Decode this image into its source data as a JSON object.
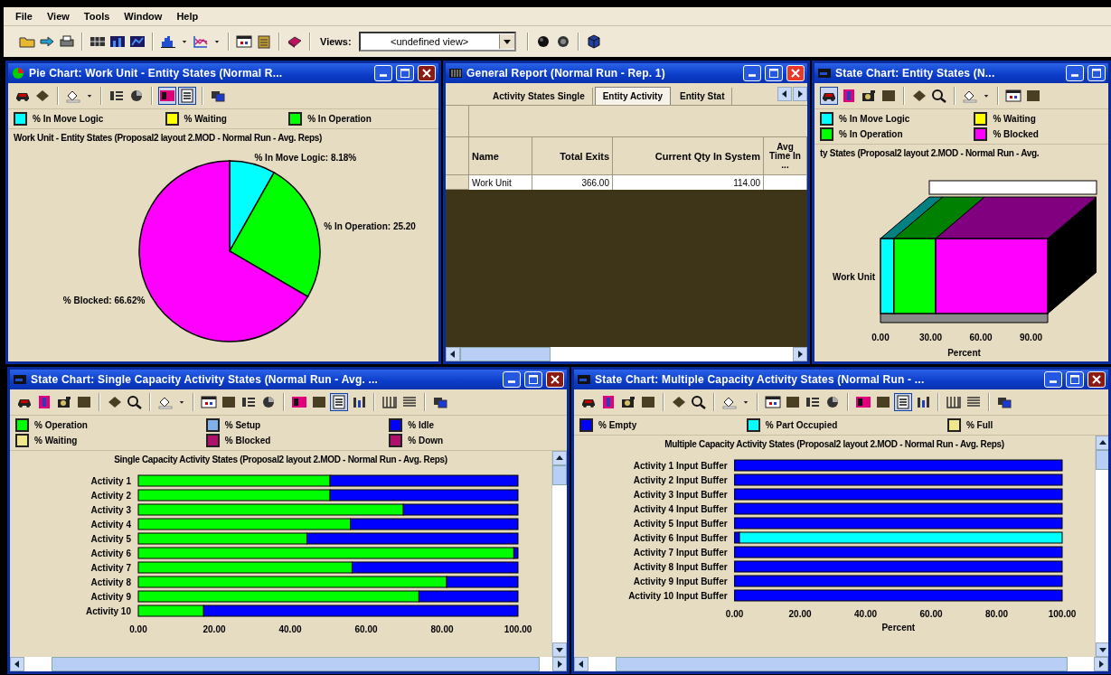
{
  "menu": [
    "File",
    "View",
    "Tools",
    "Window",
    "Help"
  ],
  "toolbar": {
    "left": [
      {
        "kind": "folder"
      },
      {
        "kind": "link"
      },
      {
        "kind": "printer"
      },
      {
        "kind": "sep"
      },
      {
        "kind": "table"
      },
      {
        "kind": "barchart"
      },
      {
        "kind": "barchart2"
      },
      {
        "kind": "sep"
      },
      {
        "kind": "histogram"
      },
      {
        "kind": "caret"
      },
      {
        "kind": "linechart"
      },
      {
        "kind": "caret"
      },
      {
        "kind": "sep"
      },
      {
        "kind": "window"
      },
      {
        "kind": "doc"
      },
      {
        "kind": "sep"
      },
      {
        "kind": "book"
      },
      {
        "kind": "sep"
      }
    ],
    "views_label": "Views:",
    "views_value": "<undefined view>",
    "right": [
      {
        "kind": "sep"
      },
      {
        "kind": "ball"
      },
      {
        "kind": "ball2"
      },
      {
        "kind": "sep"
      },
      {
        "kind": "cube"
      }
    ]
  },
  "windows": [
    {
      "kind": "pie",
      "title": "Pie Chart: Work Unit - Entity States (Normal R...",
      "active": false,
      "buttons": [
        {
          "kind": "minimize"
        },
        {
          "kind": "maximize"
        },
        {
          "kind": "close"
        }
      ],
      "toolbar": [
        {
          "kind": "car",
          "pressed": false
        },
        {
          "kind": "diamond",
          "pressed": false
        },
        {
          "kind": "sep"
        },
        {
          "kind": "paint",
          "pressed": false
        },
        {
          "kind": "caret",
          "pressed": false
        },
        {
          "kind": "sep"
        },
        {
          "kind": "labels",
          "pressed": false
        },
        {
          "kind": "pie",
          "pressed": false
        },
        {
          "kind": "sep"
        },
        {
          "kind": "legend",
          "pressed": true
        },
        {
          "kind": "text",
          "pressed": true
        },
        {
          "kind": "sep"
        },
        {
          "kind": "copy",
          "pressed": false
        }
      ],
      "legend": [
        {
          "label": "% In Move Logic",
          "color": "#00ffff"
        },
        {
          "label": "% Waiting",
          "color": "#ffff00"
        },
        {
          "label": "% In Operation",
          "color": "#00ff00"
        }
      ],
      "chart_data": {
        "type": "pie",
        "title": "Work Unit - Entity States (Proposal2 layout 2.MOD - Normal Run - Avg. Reps)",
        "categories": [
          "% In Move Logic",
          "% In Operation",
          "% Blocked"
        ],
        "values": [
          8.18,
          25.2,
          66.62
        ],
        "colors": [
          "#00ffff",
          "#00ff00",
          "#ff00ff"
        ],
        "value_labels": [
          "8.18%",
          "25.20",
          "66.62%"
        ]
      }
    },
    {
      "kind": "report",
      "title": "General Report (Normal Run - Rep. 1)",
      "active": true,
      "buttons": [
        {
          "kind": "minimize"
        },
        {
          "kind": "maximize"
        },
        {
          "kind": "close"
        }
      ],
      "tabs": [
        {
          "label": "Activity States Single",
          "selected": false
        },
        {
          "label": "Entity Activity",
          "selected": true
        },
        {
          "label": "Entity Stat",
          "selected": false
        }
      ],
      "table": {
        "columns": [
          "Name",
          "Total Exits",
          "Current Qty In System",
          "Avg Time In ..."
        ],
        "rows": [
          [
            "Work Unit",
            "366.00",
            "114.00"
          ]
        ]
      }
    },
    {
      "kind": "state3d",
      "title": "State Chart: Entity States (N...",
      "buttons": [
        {
          "kind": "minimize"
        },
        {
          "kind": "maximize"
        }
      ],
      "toolbar": [
        {
          "kind": "car",
          "pressed": true
        },
        {
          "kind": "info",
          "pressed": false
        },
        {
          "kind": "camera",
          "pressed": false
        },
        {
          "kind": "square",
          "pressed": false
        },
        {
          "kind": "sep"
        },
        {
          "kind": "diamond",
          "pressed": false
        },
        {
          "kind": "search",
          "pressed": false
        },
        {
          "kind": "sep"
        },
        {
          "kind": "paint",
          "pressed": false
        },
        {
          "kind": "caret",
          "pressed": false
        },
        {
          "kind": "sep"
        },
        {
          "kind": "window",
          "pressed": false
        },
        {
          "kind": "square",
          "pressed": false
        }
      ],
      "chart_data": {
        "type": "bar",
        "orientation": "horizontal",
        "stacked": true,
        "title": "ty States (Proposal2 layout 2.MOD - Normal Run - Avg.",
        "categories": [
          "Work Unit"
        ],
        "series": [
          {
            "name": "% In Move Logic",
            "color": "#00ffff",
            "values": [
              8
            ]
          },
          {
            "name": "% In Operation",
            "color": "#00ff00",
            "values": [
              25
            ]
          },
          {
            "name": "% Waiting",
            "color": "#ffff00",
            "values": [
              0
            ]
          },
          {
            "name": "% Blocked",
            "color": "#ff00ff",
            "values": [
              67
            ]
          }
        ],
        "xlabel": "Percent",
        "xlim": [
          0,
          100
        ],
        "xticks": [
          {
            "value": 0,
            "label": "0.00"
          },
          {
            "value": 30,
            "label": "30.00"
          },
          {
            "value": 60,
            "label": "60.00"
          },
          {
            "value": 90,
            "label": "90.00"
          }
        ]
      }
    },
    {
      "kind": "hbar",
      "title": "State Chart: Single Capacity Activity States (Normal Run - Avg. ...",
      "active": false,
      "buttons": [
        {
          "kind": "minimize"
        },
        {
          "kind": "maximize"
        },
        {
          "kind": "close"
        }
      ],
      "toolbar": [
        {
          "kind": "car",
          "pressed": false
        },
        {
          "kind": "info",
          "pressed": false
        },
        {
          "kind": "camera",
          "pressed": false
        },
        {
          "kind": "square",
          "pressed": false
        },
        {
          "kind": "sep"
        },
        {
          "kind": "diamond",
          "pressed": false
        },
        {
          "kind": "search",
          "pressed": false
        },
        {
          "kind": "sep"
        },
        {
          "kind": "paint",
          "pressed": false
        },
        {
          "kind": "caret",
          "pressed": false
        },
        {
          "kind": "sep"
        },
        {
          "kind": "window",
          "pressed": false
        },
        {
          "kind": "square",
          "pressed": false
        },
        {
          "kind": "labels",
          "pressed": false
        },
        {
          "kind": "pie",
          "pressed": false
        },
        {
          "kind": "sep"
        },
        {
          "kind": "legend",
          "pressed": false
        },
        {
          "kind": "square",
          "pressed": false
        },
        {
          "kind": "text",
          "pressed": true
        },
        {
          "kind": "bars",
          "pressed": false
        },
        {
          "kind": "sep"
        },
        {
          "kind": "columns",
          "pressed": false
        },
        {
          "kind": "lines",
          "pressed": false
        },
        {
          "kind": "sep"
        },
        {
          "kind": "copy",
          "pressed": false
        }
      ],
      "chart_data": {
        "type": "bar",
        "orientation": "horizontal",
        "stacked": true,
        "title": "Single Capacity Activity States (Proposal2 layout 2.MOD - Normal Run - Avg. Reps)",
        "categories": [
          "Activity 1",
          "Activity 2",
          "Activity 3",
          "Activity 4",
          "Activity 5",
          "Activity 6",
          "Activity 7",
          "Activity 8",
          "Activity 9",
          "Activity 10"
        ],
        "series": [
          {
            "name": "% Operation",
            "color": "#00ff00",
            "values": [
              50.5,
              50.5,
              69.8,
              55.9,
              44.4,
              98.9,
              56.3,
              81.2,
              73.9,
              17.2
            ]
          },
          {
            "name": "% Waiting",
            "color": "#f0e68c",
            "values": [
              0,
              0,
              0,
              0,
              0,
              0,
              0,
              0,
              0,
              0
            ]
          },
          {
            "name": "% Setup",
            "color": "#80b0e8",
            "values": [
              0,
              0,
              0,
              0,
              0,
              0,
              0,
              0,
              0,
              0
            ]
          },
          {
            "name": "% Blocked",
            "color": "#b0106a",
            "values": [
              0,
              0,
              0,
              0,
              0,
              0,
              0,
              0,
              0,
              0
            ]
          },
          {
            "name": "% Idle",
            "color": "#0000ff",
            "values": [
              49.5,
              49.5,
              30.2,
              44.1,
              55.6,
              1.1,
              43.7,
              18.8,
              26.1,
              82.8
            ]
          },
          {
            "name": "% Down",
            "color": "#b0106b",
            "values": [
              0,
              0,
              0,
              0,
              0,
              0,
              0,
              0,
              0,
              0
            ]
          }
        ],
        "xlim": [
          0,
          100
        ],
        "xticks": [
          {
            "value": 0,
            "label": "0.00"
          },
          {
            "value": 20,
            "label": "20.00"
          },
          {
            "value": 40,
            "label": "40.00"
          },
          {
            "value": 60,
            "label": "60.00"
          },
          {
            "value": 80,
            "label": "80.00"
          },
          {
            "value": 100,
            "label": "100.00"
          }
        ]
      }
    },
    {
      "kind": "hbar",
      "title": "State Chart: Multiple Capacity Activity States (Normal Run - ...",
      "active": false,
      "buttons": [
        {
          "kind": "minimize"
        },
        {
          "kind": "maximize"
        },
        {
          "kind": "close"
        }
      ],
      "toolbar": [
        {
          "kind": "car",
          "pressed": false
        },
        {
          "kind": "info",
          "pressed": false
        },
        {
          "kind": "camera",
          "pressed": false
        },
        {
          "kind": "square",
          "pressed": false
        },
        {
          "kind": "sep"
        },
        {
          "kind": "diamond",
          "pressed": false
        },
        {
          "kind": "search",
          "pressed": false
        },
        {
          "kind": "sep"
        },
        {
          "kind": "paint",
          "pressed": false
        },
        {
          "kind": "caret",
          "pressed": false
        },
        {
          "kind": "sep"
        },
        {
          "kind": "window",
          "pressed": false
        },
        {
          "kind": "square",
          "pressed": false
        },
        {
          "kind": "labels",
          "pressed": false
        },
        {
          "kind": "pie",
          "pressed": false
        },
        {
          "kind": "sep"
        },
        {
          "kind": "legend",
          "pressed": false
        },
        {
          "kind": "square",
          "pressed": false
        },
        {
          "kind": "text",
          "pressed": true
        },
        {
          "kind": "bars",
          "pressed": false
        },
        {
          "kind": "sep"
        },
        {
          "kind": "columns",
          "pressed": false
        },
        {
          "kind": "lines",
          "pressed": false
        },
        {
          "kind": "sep"
        },
        {
          "kind": "copy",
          "pressed": false
        }
      ],
      "chart_data": {
        "type": "bar",
        "orientation": "horizontal",
        "stacked": true,
        "title": "Multiple Capacity Activity States (Proposal2 layout 2.MOD - Normal Run - Avg. Reps)",
        "categories": [
          "Activity 1 Input Buffer",
          "Activity 2 Input Buffer",
          "Activity 3 Input Buffer",
          "Activity 4 Input Buffer",
          "Activity 5 Input Buffer",
          "Activity 6 Input Buffer",
          "Activity 7 Input Buffer",
          "Activity 8 Input Buffer",
          "Activity 9 Input Buffer",
          "Activity 10 Input Buffer"
        ],
        "series": [
          {
            "name": "% Empty",
            "color": "#0000ff",
            "values": [
              100,
              100,
              100,
              100,
              100,
              1.5,
              100,
              100,
              100,
              100
            ]
          },
          {
            "name": "% Part Occupied",
            "color": "#00ffff",
            "values": [
              0,
              0,
              0,
              0,
              0,
              98.5,
              0,
              0,
              0,
              0
            ]
          },
          {
            "name": "% Full",
            "color": "#f0e68c",
            "values": [
              0,
              0,
              0,
              0,
              0,
              0,
              0,
              0,
              0,
              0
            ]
          }
        ],
        "xlabel": "Percent",
        "xlim": [
          0,
          100
        ],
        "xticks": [
          {
            "value": 0,
            "label": "0.00"
          },
          {
            "value": 20,
            "label": "20.00"
          },
          {
            "value": 40,
            "label": "40.00"
          },
          {
            "value": 60,
            "label": "60.00"
          },
          {
            "value": 80,
            "label": "80.00"
          },
          {
            "value": 100,
            "label": "100.00"
          }
        ]
      }
    }
  ]
}
